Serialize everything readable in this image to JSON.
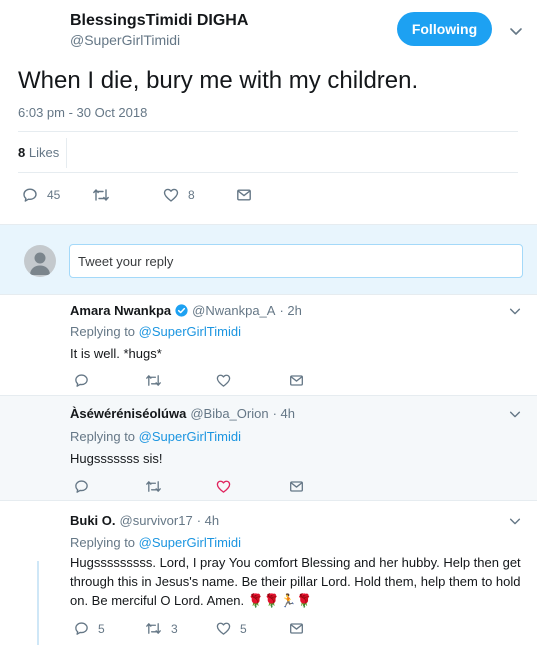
{
  "tweet": {
    "author_name": "BlessingsTimidi DIGHA",
    "author_handle": "@SuperGirlTimidi",
    "follow_button": "Following",
    "text": "When I die, bury me with my children.",
    "timestamp": "6:03 pm - 30 Oct 2018",
    "likes_count": "8",
    "likes_label": "Likes",
    "replies_count": "45",
    "retweets_count": "",
    "like_count_action": "8"
  },
  "composer": {
    "placeholder": "Tweet your reply"
  },
  "replies": [
    {
      "name": "Amara Nwankpa",
      "handle": "@Nwankpa_A",
      "time": "· 2h",
      "verified": true,
      "replying_prefix": "Replying to",
      "replying_to": "@SuperGirlTimidi",
      "text": "It is well. *hugs*",
      "reply_count": "",
      "retweet_count": "",
      "like_count": "",
      "liked": false
    },
    {
      "name": "Àséwéréniséolúwa",
      "handle": "@Biba_Orion",
      "time": "· 4h",
      "verified": false,
      "replying_prefix": "Replying to",
      "replying_to": "@SuperGirlTimidi",
      "text": "Hugsssssss sis!",
      "reply_count": "",
      "retweet_count": "",
      "like_count": "",
      "liked": true
    },
    {
      "name": "Buki O.",
      "handle": "@survivor17",
      "time": "· 4h",
      "verified": false,
      "replying_prefix": "Replying to",
      "replying_to": "@SuperGirlTimidi",
      "text": "Hugsssssssss. Lord, I pray You comfort Blessing and her hubby. Help then get through this in Jesus's name. Be their pillar Lord. Hold them, help them to hold on. Be merciful O Lord. Amen. 🌹🌹🏃🌹",
      "reply_count": "5",
      "retweet_count": "3",
      "like_count": "5",
      "liked": false
    }
  ],
  "colors": {
    "accent": "#1da1f2",
    "link": "#1b95e0",
    "like_active": "#e0245e",
    "muted": "#657786",
    "divider": "#e6ecf0"
  }
}
